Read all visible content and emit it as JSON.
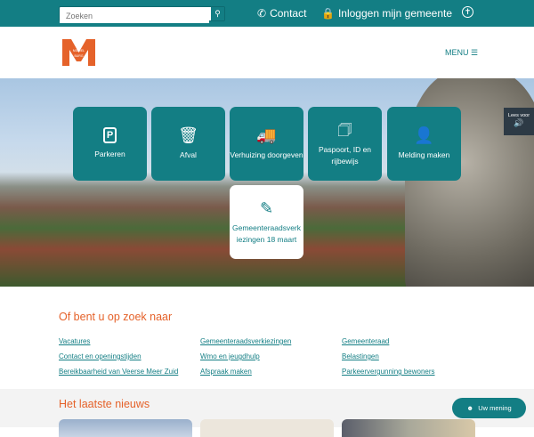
{
  "topbar": {
    "search_placeholder": "Zoeken",
    "contact": "Contact",
    "login": "Inloggen mijn gemeente"
  },
  "header": {
    "logo_text": "MIDDELBURG",
    "menu": "MENU"
  },
  "tiles": [
    {
      "label": "Parkeren",
      "icon": "parking-icon"
    },
    {
      "label": "Afval",
      "icon": "trash-icon"
    },
    {
      "label": "Verhuizing doorgeven",
      "icon": "moving-truck-icon"
    },
    {
      "label": "Paspoort, ID en rijbewijs",
      "icon": "passport-icon"
    },
    {
      "label": "Melding maken",
      "icon": "report-icon"
    },
    {
      "label": "Gemeenteraadsverkiezingen 18 maart",
      "icon": "vote-pencil-icon"
    }
  ],
  "read_aloud": {
    "label": "Lees voor"
  },
  "search_more": {
    "title": "Of bent u op zoek naar",
    "links": [
      "Vacatures",
      "Contact en openingstijden",
      "Bereikbaarheid van Veerse Meer Zuid",
      "Gemeenteraadsverkiezingen",
      "Wmo en jeugdhulp",
      "Afspraak maken",
      "Gemeenteraad",
      "Belastingen",
      "Parkeervergunning bewoners"
    ]
  },
  "news": {
    "title": "Het laatste nieuws"
  },
  "feedback": {
    "label": "Uw mening"
  },
  "colors": {
    "teal": "#137e84",
    "orange": "#e5622a"
  }
}
